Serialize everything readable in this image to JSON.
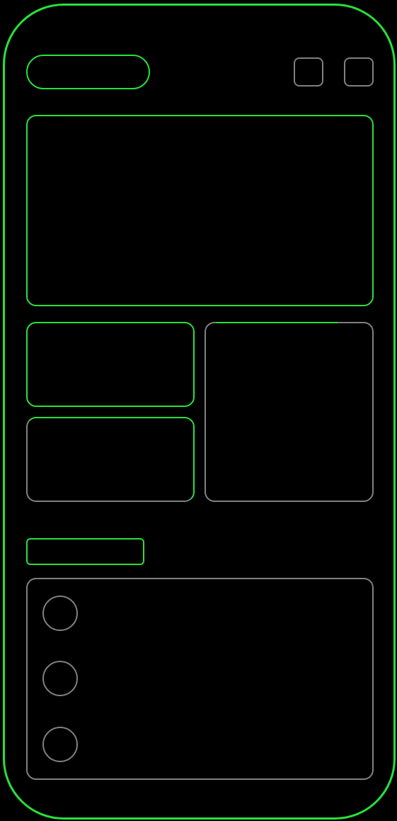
{
  "colors": {
    "accent": "#27e03a",
    "muted": "#808080",
    "background": "#000000"
  },
  "header": {
    "search_pill_text": "",
    "icon_1": "square-icon",
    "icon_2": "square-icon"
  },
  "list": {
    "items": [
      {
        "avatar_icon": "avatar-circle-icon"
      },
      {
        "avatar_icon": "avatar-circle-icon"
      },
      {
        "avatar_icon": "avatar-circle-icon"
      }
    ]
  }
}
